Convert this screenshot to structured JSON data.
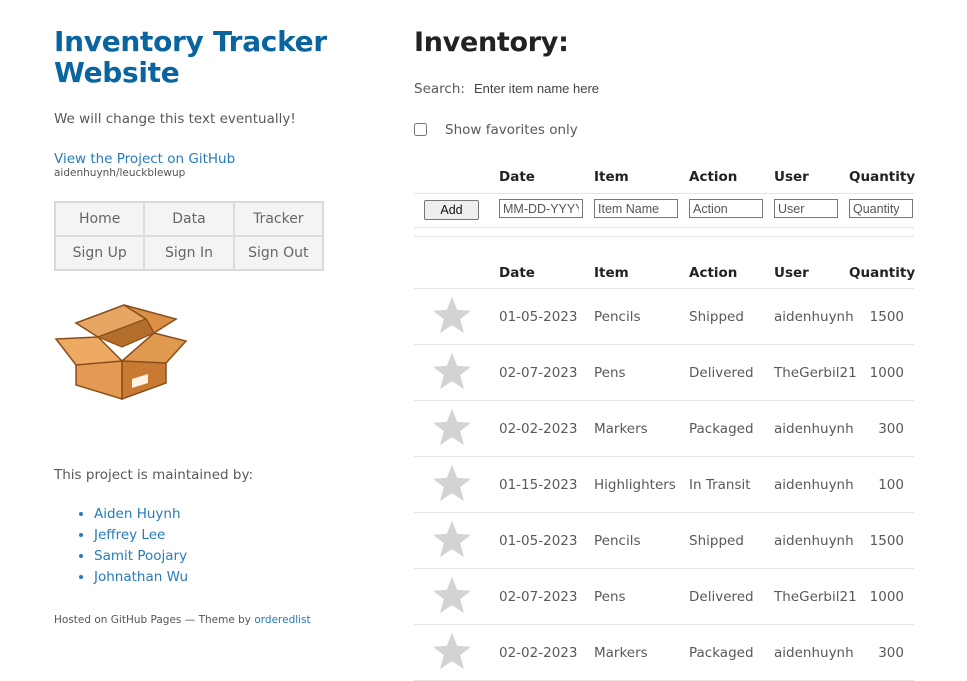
{
  "sidebar": {
    "site_title": "Inventory Tracker Website",
    "tagline": "We will change this text eventually!",
    "github_link": "View the Project on GitHub",
    "github_sub": "aidenhuynh/leuckblewup",
    "nav": [
      "Home",
      "Data",
      "Tracker",
      "Sign Up",
      "Sign In",
      "Sign Out"
    ],
    "logo_icon": "cardboard-box-icon",
    "maintained_label": "This project is maintained by:",
    "maintainers": [
      "Aiden Huynh",
      "Jeffrey Lee",
      "Samit Poojary",
      "Johnathan Wu"
    ],
    "hosted_prefix": "Hosted on GitHub Pages — Theme by ",
    "hosted_link": "orderedlist"
  },
  "main": {
    "title": "Inventory:",
    "search_label": "Search:",
    "search_placeholder": "Enter item name here",
    "favorites_label": "Show favorites only",
    "favorites_checked": false,
    "columns": [
      "Date",
      "Item",
      "Action",
      "User",
      "Quantity"
    ],
    "add_row": {
      "button_label": "Add",
      "placeholders": [
        "MM-DD-YYYY",
        "Item Name",
        "Action",
        "User",
        "Quantity"
      ]
    },
    "star_icon": "star-icon",
    "star_color": "#d3d3d3",
    "rows": [
      {
        "date": "01-05-2023",
        "item": "Pencils",
        "action": "Shipped",
        "user": "aidenhuynh",
        "quantity": "1500"
      },
      {
        "date": "02-07-2023",
        "item": "Pens",
        "action": "Delivered",
        "user": "TheGerbil21",
        "quantity": "1000"
      },
      {
        "date": "02-02-2023",
        "item": "Markers",
        "action": "Packaged",
        "user": "aidenhuynh",
        "quantity": "300"
      },
      {
        "date": "01-15-2023",
        "item": "Highlighters",
        "action": "In Transit",
        "user": "aidenhuynh",
        "quantity": "100"
      },
      {
        "date": "01-05-2023",
        "item": "Pencils",
        "action": "Shipped",
        "user": "aidenhuynh",
        "quantity": "1500"
      },
      {
        "date": "02-07-2023",
        "item": "Pens",
        "action": "Delivered",
        "user": "TheGerbil21",
        "quantity": "1000"
      },
      {
        "date": "02-02-2023",
        "item": "Markers",
        "action": "Packaged",
        "user": "aidenhuynh",
        "quantity": "300"
      }
    ]
  }
}
